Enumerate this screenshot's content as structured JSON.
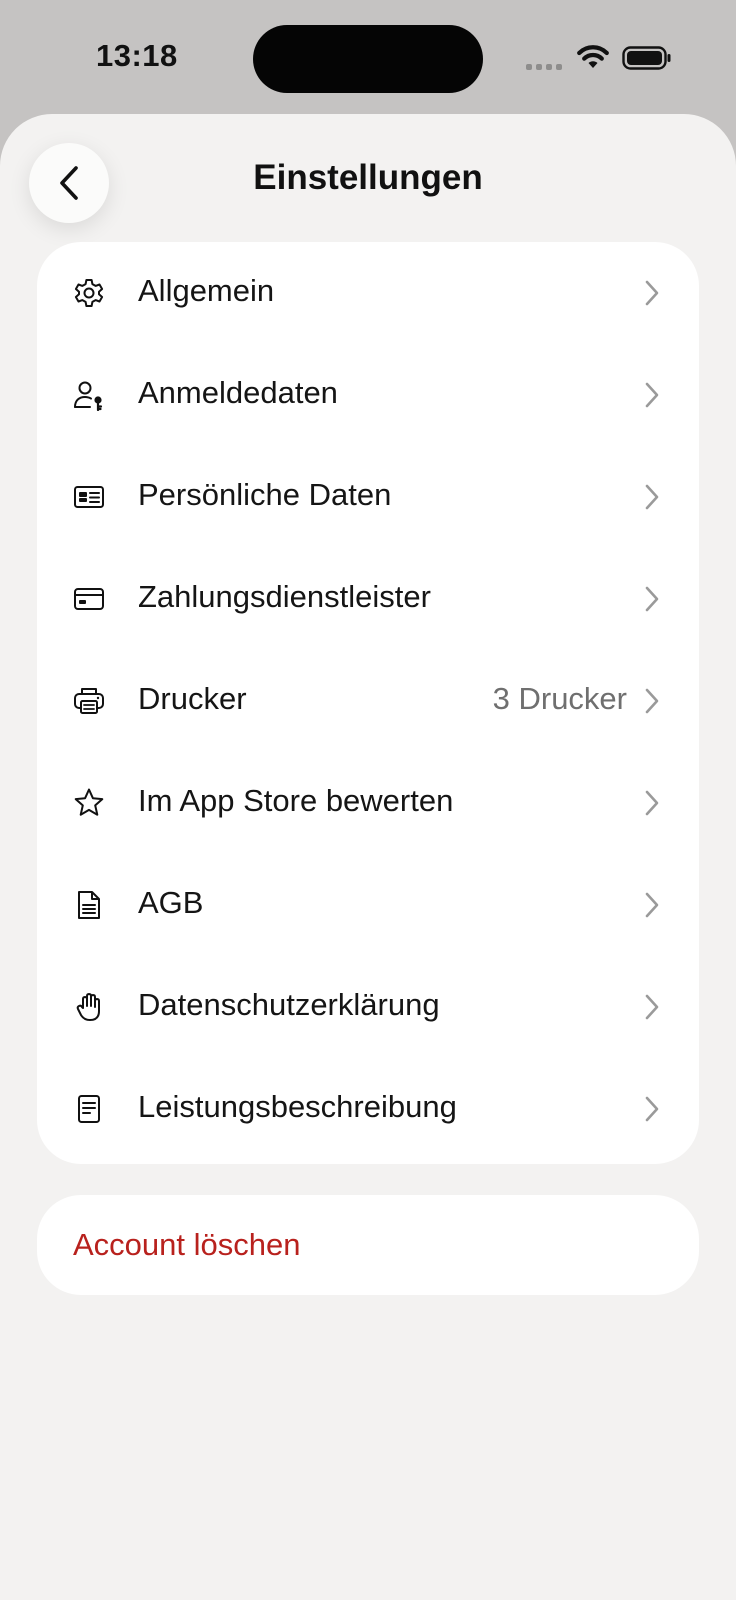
{
  "status_bar": {
    "time": "13:18"
  },
  "header": {
    "title": "Einstellungen",
    "back_icon": "chevron-left-icon"
  },
  "settings": {
    "items": [
      {
        "label": "Allgemein",
        "value": "",
        "icon": "gear-icon"
      },
      {
        "label": "Anmeldedaten",
        "value": "",
        "icon": "user-key-icon"
      },
      {
        "label": "Persönliche Daten",
        "value": "",
        "icon": "id-card-icon"
      },
      {
        "label": "Zahlungsdienstleister",
        "value": "",
        "icon": "credit-card-icon"
      },
      {
        "label": "Drucker",
        "value": "3 Drucker",
        "icon": "printer-icon"
      },
      {
        "label": "Im App Store bewerten",
        "value": "",
        "icon": "star-icon"
      },
      {
        "label": "AGB",
        "value": "",
        "icon": "document-icon"
      },
      {
        "label": "Datenschutzerklärung",
        "value": "",
        "icon": "hand-icon"
      },
      {
        "label": "Leistungsbeschreibung",
        "value": "",
        "icon": "receipt-icon"
      }
    ]
  },
  "account": {
    "delete_label": "Account löschen"
  },
  "colors": {
    "background": "#f3f2f1",
    "card": "#ffffff",
    "danger": "#b8211d",
    "secondary_text": "#6f6f6f",
    "chevron": "#9a9a9a"
  }
}
